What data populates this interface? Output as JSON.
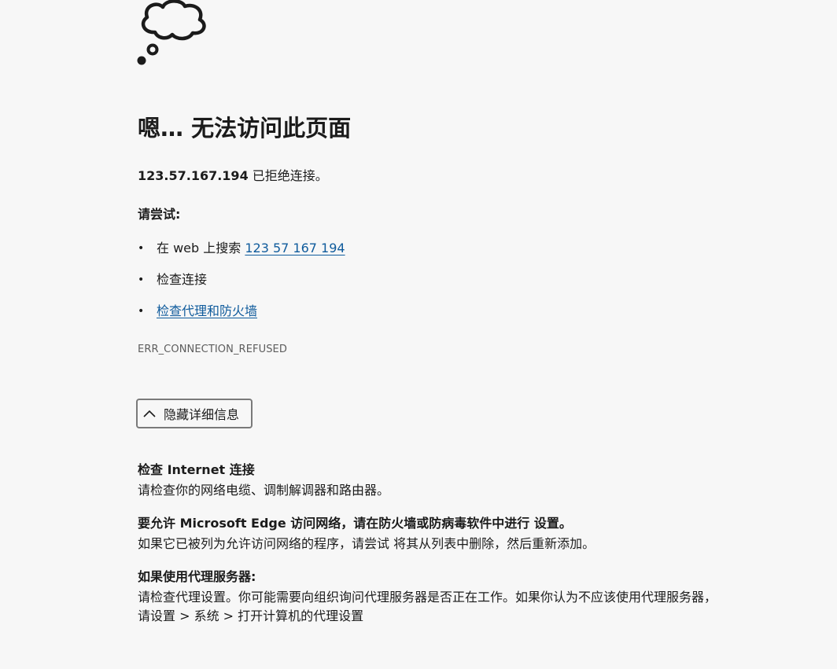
{
  "page": {
    "icon": "thought-cloud-icon",
    "title": "嗯… 无法访问此页面",
    "summary": {
      "host": "123.57.167.194",
      "message": " 已拒绝连接。"
    },
    "try_heading": "请尝试:",
    "suggestions": [
      {
        "prefix": "在 web 上搜索 ",
        "link": "123 57 167 194"
      },
      {
        "text": "检查连接"
      },
      {
        "link": "检查代理和防火墙"
      }
    ],
    "error_code": "ERR_CONNECTION_REFUSED",
    "details_button": {
      "icon": "chevron-up-icon",
      "label": "隐藏详细信息"
    },
    "details": [
      {
        "heading": "检查 Internet 连接",
        "body": "请检查你的网络电缆、调制解调器和路由器。"
      },
      {
        "heading": "要允许 Microsoft Edge 访问网络，请在防火墙或防病毒软件中进行 设置。",
        "body": "如果它已被列为允许访问网络的程序，请尝试 将其从列表中删除，然后重新添加。"
      },
      {
        "heading": "如果使用代理服务器:",
        "body": "请检查代理设置。你可能需要向组织询问代理服务器是否正在工作。如果你认为不应该使用代理服务器，请设置 > 系统 > 打开计算机的代理设置"
      }
    ]
  }
}
